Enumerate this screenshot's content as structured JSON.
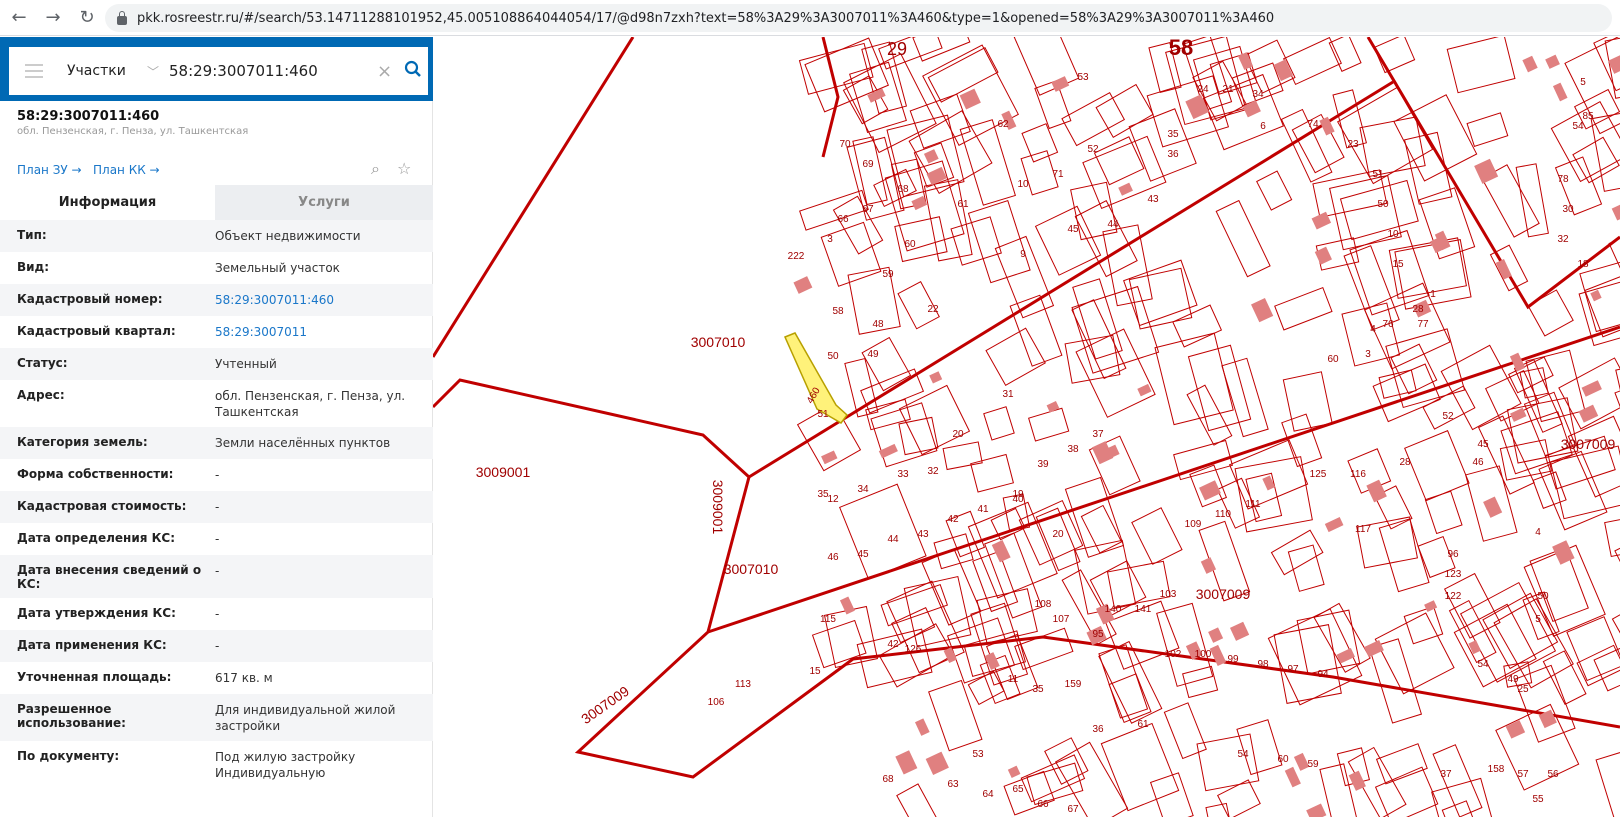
{
  "browser": {
    "back": "←",
    "forward": "→",
    "reload": "↻",
    "url": "pkk.rosreestr.ru/#/search/53.14711288101952,45.005108864044054/17/@d98n7zxh?text=58%3A29%3A3007011%3A460&type=1&opened=58%3A29%3A3007011%3A460"
  },
  "search": {
    "type": "Участки",
    "query": "58:29:3007011:460"
  },
  "object": {
    "number": "58:29:3007011:460",
    "address": "обл. Пензенская, г. Пенза, ул. Ташкентская",
    "plan_zu": "План ЗУ →",
    "plan_kk": "План КК →"
  },
  "tabs": [
    "Информация",
    "Услуги"
  ],
  "info": [
    {
      "k": "Тип:",
      "v": "Объект недвижимости"
    },
    {
      "k": "Вид:",
      "v": "Земельный участок"
    },
    {
      "k": "Кадастровый номер:",
      "v": "58:29:3007011:460",
      "link": true
    },
    {
      "k": "Кадастровый квартал:",
      "v": "58:29:3007011",
      "link": true
    },
    {
      "k": "Статус:",
      "v": "Учтенный"
    },
    {
      "k": "Адрес:",
      "v": "обл. Пензенская, г. Пенза, ул. Ташкентская"
    },
    {
      "k": "Категория земель:",
      "v": "Земли населённых пунктов"
    },
    {
      "k": "Форма собственности:",
      "v": "-"
    },
    {
      "k": "Кадастровая стоимость:",
      "v": "-"
    },
    {
      "k": "Дата определения КС:",
      "v": "-"
    },
    {
      "k": "Дата внесения сведений о КС:",
      "v": "-"
    },
    {
      "k": "Дата утверждения КС:",
      "v": "-"
    },
    {
      "k": "Дата применения КС:",
      "v": "-"
    },
    {
      "k": "Уточненная площадь:",
      "v": "617 кв. м"
    },
    {
      "k": "Разрешенное использование:",
      "v": "Для индивидуальной жилой застройки"
    },
    {
      "k": "По документу:",
      "v": "Под жилую застройку Индивидуальную"
    }
  ],
  "map": {
    "colors": {
      "line": "#c00000",
      "building": "#e08080",
      "selected": "#fff27a"
    },
    "labels": [
      "3009001",
      "3009001",
      "3007010",
      "3007010",
      "3007009",
      "3007009",
      "3007009",
      "58",
      "29",
      "460",
      "50",
      "49",
      "51",
      "58",
      "48",
      "22",
      "59",
      "60",
      "3",
      "222",
      "70",
      "69",
      "66",
      "67",
      "68",
      "62",
      "10",
      "61",
      "9",
      "45",
      "44",
      "43",
      "53",
      "52",
      "71",
      "35",
      "36",
      "24",
      "21",
      "6",
      "34",
      "74",
      "23",
      "51",
      "50",
      "10",
      "15",
      "1",
      "28",
      "77",
      "76",
      "4",
      "3",
      "60",
      "12",
      "34",
      "33",
      "32",
      "20",
      "31",
      "35",
      "46",
      "45",
      "44",
      "43",
      "42",
      "41",
      "40",
      "39",
      "38",
      "37",
      "19",
      "125",
      "111",
      "110",
      "109",
      "116",
      "117",
      "28",
      "46",
      "45",
      "52",
      "42",
      "126",
      "106",
      "113",
      "115",
      "15",
      "20",
      "108",
      "107",
      "95",
      "140",
      "141",
      "103",
      "102",
      "100",
      "99",
      "98",
      "97",
      "94",
      "122",
      "123",
      "96",
      "4",
      "50",
      "5",
      "54",
      "49",
      "11",
      "35",
      "159",
      "36",
      "61",
      "60",
      "59",
      "37",
      "158",
      "57",
      "56",
      "55",
      "54",
      "53",
      "63",
      "64",
      "65",
      "66",
      "67",
      "68",
      "25",
      "54",
      "78",
      "30",
      "32",
      "18",
      "85",
      "5",
      "22"
    ]
  }
}
